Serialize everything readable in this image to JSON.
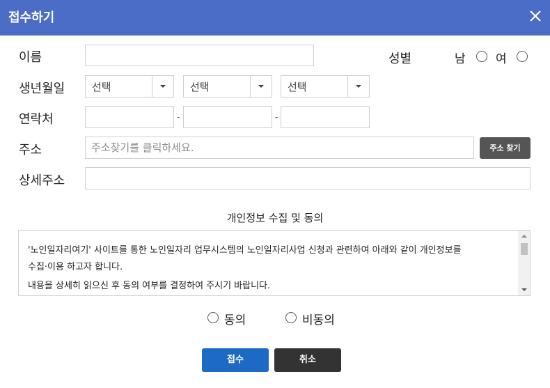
{
  "dialog": {
    "title": "접수하기",
    "close_icon": "close-icon"
  },
  "form": {
    "name_label": "이름",
    "name_value": "",
    "gender_label": "성별",
    "gender_options": [
      "남",
      "여"
    ],
    "birth_label": "생년월일",
    "birth_selects": [
      "선택",
      "선택",
      "선택"
    ],
    "contact_label": "연락처",
    "contact_sep": "-",
    "contact_values": [
      "",
      "",
      ""
    ],
    "address_label": "주소",
    "address_placeholder": "주소찾기를 클릭하세요.",
    "address_button": "주소 찾기",
    "detail_label": "상세주소",
    "detail_value": ""
  },
  "consent": {
    "title": "개인정보 수집 및 동의",
    "text_line1": "'노인일자리여기' 사이트를 통한 노인일자리 업무시스템의 노인일자리사업 신청과 관련하여 아래와 같이 개인정보를",
    "text_line2": "수집·이용 하고자 합니다.",
    "text_line3": "내용을 상세히 읽으신 후 동의 여부를 결정하여 주시기 바랍니다.",
    "agree_label": "동의",
    "disagree_label": "비동의"
  },
  "actions": {
    "submit_label": "접수",
    "cancel_label": "취소"
  },
  "colors": {
    "header": "#4b6cc7",
    "submit": "#1d6ac6",
    "cancel": "#333333",
    "address_button": "#555555"
  }
}
